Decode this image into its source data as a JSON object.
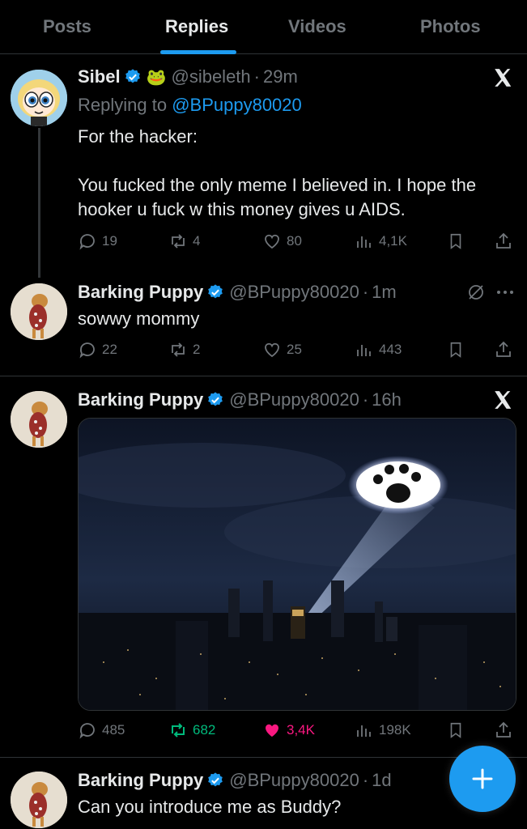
{
  "tabs": [
    "Posts",
    "Replies",
    "Videos",
    "Photos"
  ],
  "active_tab": "Replies",
  "posts": [
    {
      "name": "Sibel",
      "badge_emoji": "🐸",
      "handle": "@sibeleth",
      "time": "29m",
      "replying_prefix": "Replying to",
      "replying_to": "@BPuppy80020",
      "text_line1": "For the hacker:",
      "text_line2": "You fucked the only meme I believed in. I hope the",
      "text_line3": "hooker u fuck w this money gives u AIDS.",
      "replies": "19",
      "reposts": "4",
      "likes": "80",
      "views": "4,1K",
      "corner": "x-logo-icon"
    },
    {
      "name": "Barking Puppy",
      "handle": "@BPuppy80020",
      "time": "1m",
      "text": "sowwy mommy",
      "replies": "22",
      "reposts": "2",
      "likes": "25",
      "views": "443",
      "corner": "grok-icon"
    },
    {
      "name": "Barking Puppy",
      "handle": "@BPuppy80020",
      "time": "16h",
      "image": "night-city-paw-signal",
      "replies": "485",
      "reposts": "682",
      "likes": "3,4K",
      "views": "198K",
      "corner": "x-logo-icon"
    },
    {
      "name": "Barking Puppy",
      "handle": "@BPuppy80020",
      "time": "1d",
      "text": "Can you introduce me as Buddy?"
    }
  ],
  "colors": {
    "accent": "#1d9bf0",
    "repost_active": "#00ba7c",
    "like_active": "#f91880",
    "muted": "#71767b"
  },
  "fab_icon": "plus-icon"
}
